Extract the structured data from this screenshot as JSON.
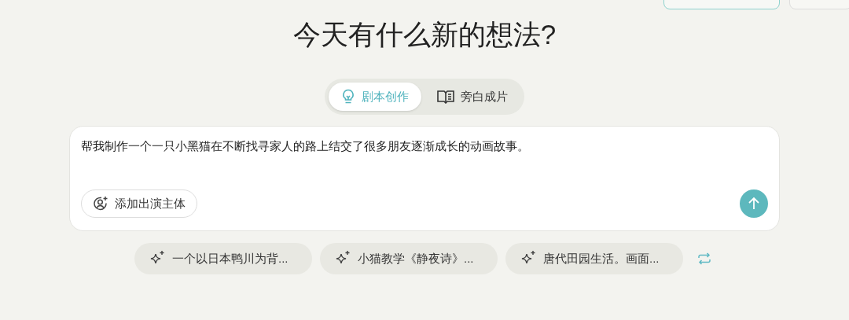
{
  "title": "今天有什么新的想法?",
  "tabs": [
    {
      "label": "剧本创作",
      "selected": true,
      "kind": "bulb"
    },
    {
      "label": "旁白成片",
      "selected": false,
      "kind": "book"
    }
  ],
  "prompt": {
    "value": "帮我制作一个一只小黑猫在不断找寻家人的路上结交了很多朋友逐渐成长的动画故事。",
    "add_button": "添加出演主体"
  },
  "suggestions": [
    "一个以日本鸭川为背...",
    "小猫教学《静夜诗》...",
    "唐代田园生活。画面..."
  ]
}
